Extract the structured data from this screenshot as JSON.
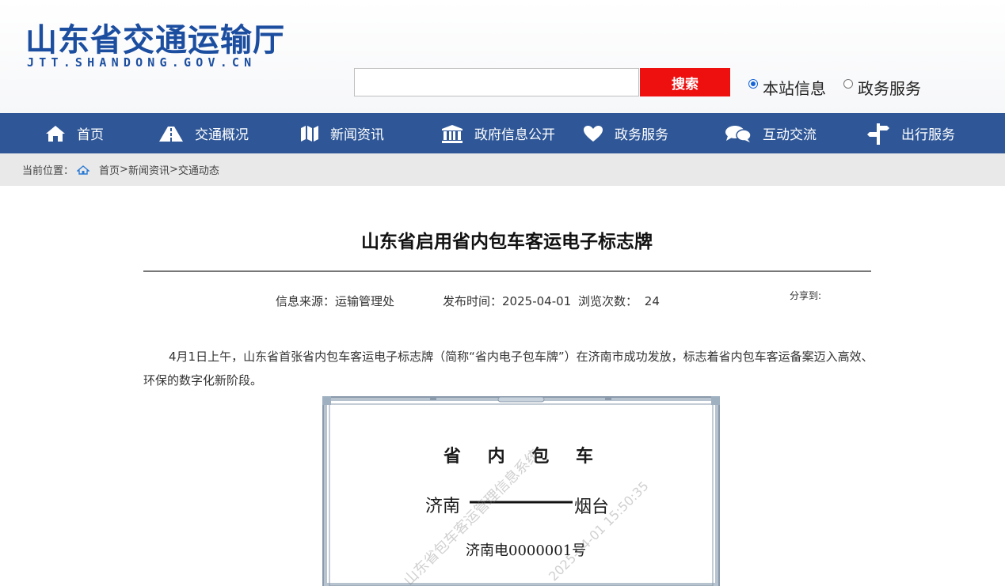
{
  "header": {
    "site_title": "山东省交通运输厅",
    "site_domain": "JTT.SHANDONG.GOV.CN",
    "brand_color": "#1c4ea0"
  },
  "search": {
    "input_value": "",
    "button_label": "搜索",
    "button_color": "#ee0f0f",
    "scope_options": [
      {
        "label": "本站信息",
        "selected": true
      },
      {
        "label": "政务服务",
        "selected": false
      }
    ]
  },
  "nav": {
    "background": "#2f5797",
    "items": [
      {
        "label": "首页",
        "icon": "home-icon"
      },
      {
        "label": "交通概况",
        "icon": "road-icon"
      },
      {
        "label": "新闻资讯",
        "icon": "map-icon"
      },
      {
        "label": "政府信息公开",
        "icon": "government-building-icon"
      },
      {
        "label": "政务服务",
        "icon": "heart-icon"
      },
      {
        "label": "互动交流",
        "icon": "chat-bubbles-icon"
      },
      {
        "label": "出行服务",
        "icon": "signpost-icon"
      }
    ]
  },
  "breadcrumb": {
    "prefix": "当前位置：",
    "home_icon": "home-icon",
    "path": [
      "首页",
      "新闻资讯",
      "交通动态"
    ],
    "separator": ">"
  },
  "article": {
    "title": "山东省启用省内包车客运电子标志牌",
    "source_label": "信息来源：",
    "source": "运输管理处",
    "date_label": "发布时间：",
    "date": "2025-04-01",
    "views_label": "浏览次数：",
    "views": "24",
    "share_label": "分享到:",
    "paragraph": "4月1日上午，山东省首张省内包车客运电子标志牌（简称“省内电子包车牌”）在济南市成功发放，标志着省内包车客运备案迈入高效、环保的数字化新阶段。"
  },
  "figure": {
    "heading": "省 内 包 车",
    "origin": "济南",
    "destination": "烟台",
    "plate_number": "济南电0000001号",
    "watermark_system": "山东省包车客运管理信息系统",
    "watermark_time": "2025-04-01 15:50:35"
  }
}
